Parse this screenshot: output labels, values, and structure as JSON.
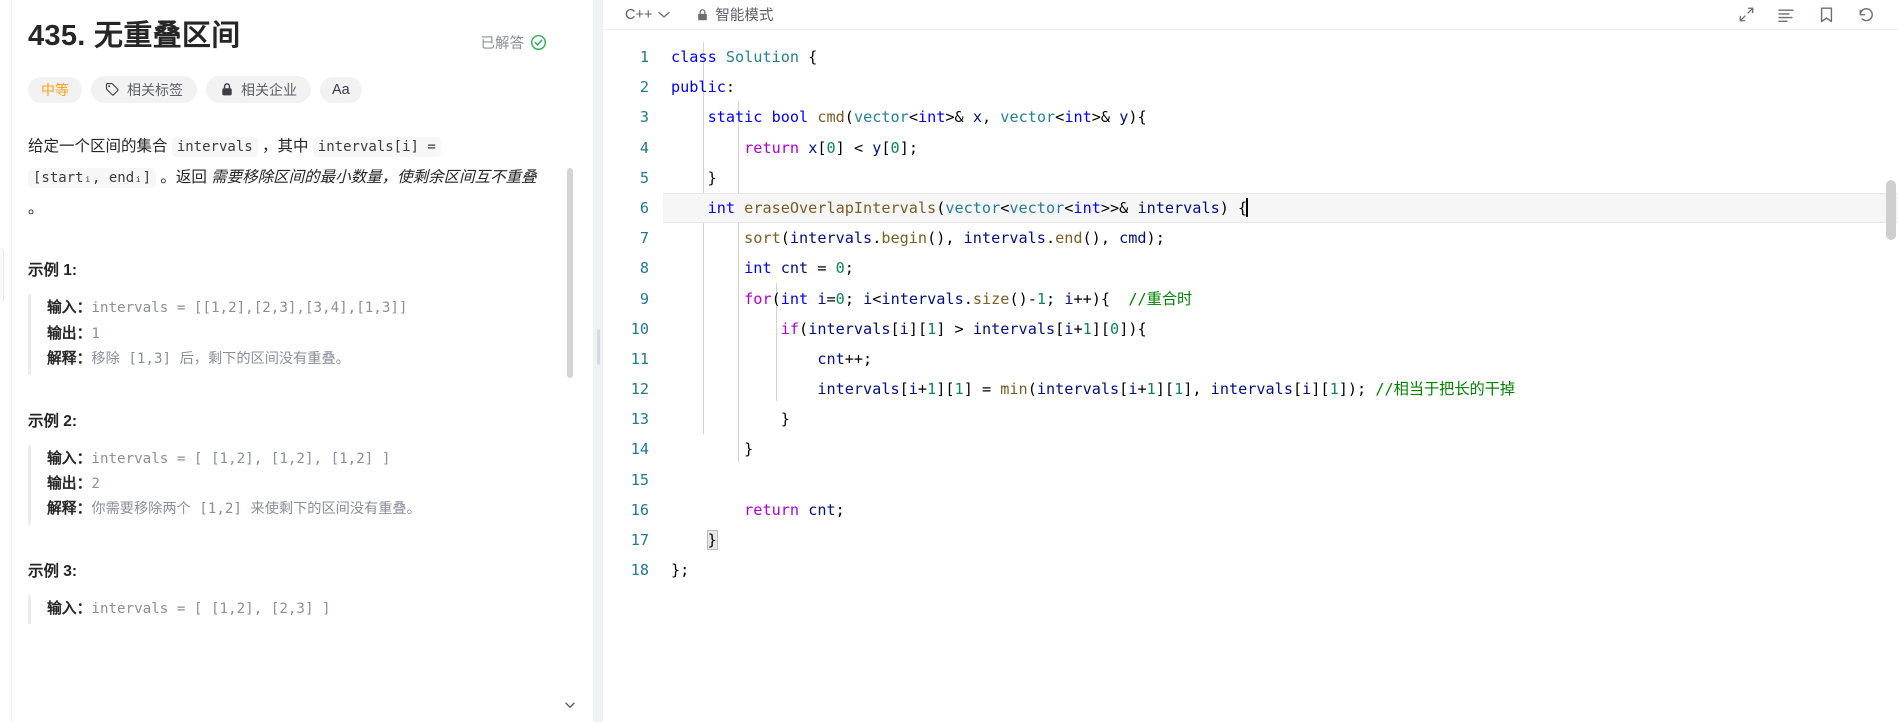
{
  "problem": {
    "number": "435.",
    "title": "无重叠区间",
    "solved_label": "已解答",
    "difficulty": "中等",
    "tags_label": "相关标签",
    "companies_label": "相关企业",
    "font_button": "Aa",
    "description": {
      "seg1": "给定一个区间的集合 ",
      "code1": "intervals",
      "seg2": " ，其中 ",
      "code2": "intervals[i] =",
      "code3": "[startᵢ, endᵢ]",
      "seg3": " 。返回 ",
      "em1": "需要移除区间的最小数量，使剩余区间互不重叠",
      "seg4": " 。"
    },
    "examples": [
      {
        "heading": "示例 1:",
        "input_label": "输入：",
        "input_value": "intervals = [[1,2],[2,3],[3,4],[1,3]]",
        "output_label": "输出：",
        "output_value": "1",
        "explain_label": "解释：",
        "explain_value": "移除 [1,3] 后，剩下的区间没有重叠。"
      },
      {
        "heading": "示例 2:",
        "input_label": "输入：",
        "input_value": "intervals = [ [1,2], [1,2], [1,2] ]",
        "output_label": "输出：",
        "output_value": "2",
        "explain_label": "解释：",
        "explain_value": "你需要移除两个 [1,2] 来使剩下的区间没有重叠。"
      },
      {
        "heading": "示例 3:",
        "input_label": "输入：",
        "input_value": "intervals = [ [1,2], [2,3] ]"
      }
    ]
  },
  "editor": {
    "language": "C++",
    "smart_mode": "智能模式",
    "icons": {
      "expand": "expand-icon",
      "format": "format-icon",
      "bookmark": "bookmark-icon",
      "reset": "reset-icon"
    },
    "active_line": 6,
    "line_numbers": [
      "1",
      "2",
      "3",
      "4",
      "5",
      "6",
      "7",
      "8",
      "9",
      "10",
      "11",
      "12",
      "13",
      "14",
      "15",
      "16",
      "17",
      "18"
    ],
    "code_lines": [
      "class Solution {",
      "public:",
      "    static bool cmd(vector<int>& x, vector<int>& y){",
      "        return x[0] < y[0];",
      "    }",
      "    int eraseOverlapIntervals(vector<vector<int>>& intervals) {",
      "        sort(intervals.begin(), intervals.end(), cmd);",
      "        int cnt = 0;",
      "        for(int i=0; i<intervals.size()-1; i++){  //重合时",
      "            if(intervals[i][1] > intervals[i+1][0]){",
      "                cnt++;",
      "                intervals[i+1][1] = min(intervals[i+1][1], intervals[i][1]); //相当于把长的干掉",
      "            }",
      "        }",
      "",
      "        return cnt;",
      "    }",
      "};"
    ],
    "comments": {
      "line9": "//重合时",
      "line12": "//相当于把长的干掉"
    }
  },
  "colors": {
    "difficulty_orange": "#ffa116",
    "solved_green": "#2db55d",
    "keyword_blue": "#0000ff",
    "control_purple": "#af00db",
    "type_teal": "#267f99",
    "function_gold": "#795e26",
    "variable_navy": "#001080",
    "number_green": "#098658",
    "comment_green": "#008000",
    "gutter_blue": "#237893"
  }
}
